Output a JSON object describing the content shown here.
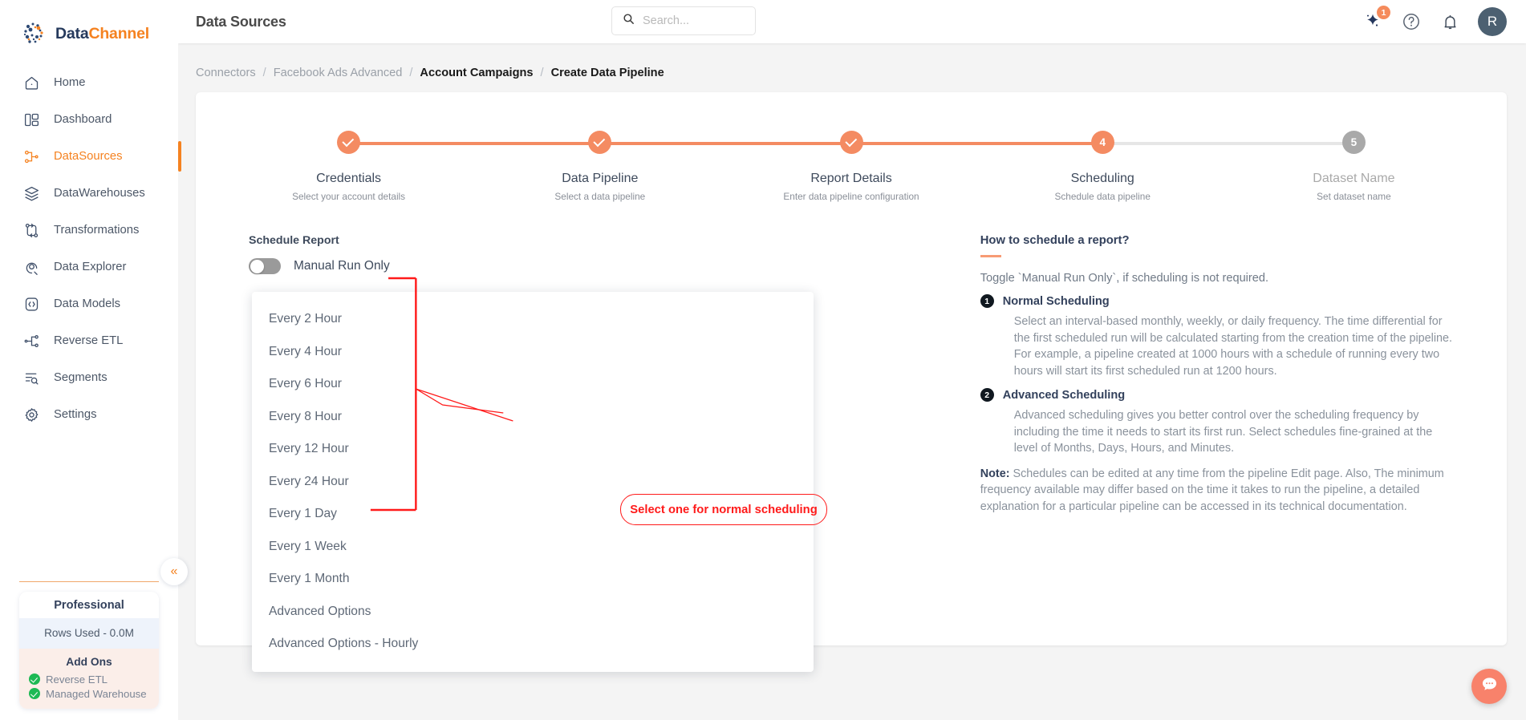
{
  "brand": {
    "part1": "Data",
    "part2": "Channel"
  },
  "sidebar": {
    "items": [
      {
        "label": "Home",
        "icon": "home-icon"
      },
      {
        "label": "Dashboard",
        "icon": "dashboard-icon"
      },
      {
        "label": "DataSources",
        "icon": "datasources-icon"
      },
      {
        "label": "DataWarehouses",
        "icon": "warehouse-icon"
      },
      {
        "label": "Transformations",
        "icon": "transformations-icon"
      },
      {
        "label": "Data Explorer",
        "icon": "explorer-icon"
      },
      {
        "label": "Data Models",
        "icon": "datamodels-icon"
      },
      {
        "label": "Reverse ETL",
        "icon": "reverse-etl-icon"
      },
      {
        "label": "Segments",
        "icon": "segments-icon"
      },
      {
        "label": "Settings",
        "icon": "gear-icon"
      }
    ],
    "active_index": 2,
    "plan": {
      "title": "Professional",
      "rows_used": "Rows Used - 0.0M",
      "addons_title": "Add Ons",
      "addons": [
        "Reverse ETL",
        "Managed Warehouse"
      ]
    },
    "collapse_icon": "«"
  },
  "header": {
    "title": "Data Sources",
    "search_placeholder": "Search...",
    "search_value": "",
    "ai_badge_count": "1",
    "avatar_initial": "R"
  },
  "breadcrumb": [
    {
      "label": "Connectors",
      "strong": false
    },
    {
      "label": "Facebook Ads Advanced",
      "strong": false
    },
    {
      "label": "Account Campaigns",
      "strong": true
    },
    {
      "label": "Create Data Pipeline",
      "strong": true
    }
  ],
  "breadcrumb_separator": "/",
  "stepper": [
    {
      "marker": "✓",
      "name": "Credentials",
      "desc": "Select your account details",
      "state": "done"
    },
    {
      "marker": "✓",
      "name": "Data Pipeline",
      "desc": "Select a data pipeline",
      "state": "done"
    },
    {
      "marker": "✓",
      "name": "Report Details",
      "desc": "Enter data pipeline configuration",
      "state": "done"
    },
    {
      "marker": "4",
      "name": "Scheduling",
      "desc": "Schedule data pipeline",
      "state": "current"
    },
    {
      "marker": "5",
      "name": "Dataset Name",
      "desc": "Set dataset name",
      "state": "upcoming"
    }
  ],
  "form": {
    "schedule_label": "Schedule Report",
    "toggle_label": "Manual Run Only",
    "toggle_state": "off",
    "options": [
      "Every 2 Hour",
      "Every 4 Hour",
      "Every 6 Hour",
      "Every 8 Hour",
      "Every 12 Hour",
      "Every 24 Hour",
      "Every 1 Day",
      "Every 1 Week",
      "Every 1 Month",
      "Advanced Options",
      "Advanced Options - Hourly"
    ]
  },
  "annotation": {
    "text": "Select one for normal scheduling",
    "color": "#ff1a1a"
  },
  "help": {
    "title": "How to schedule a report?",
    "lead": "Toggle `Manual Run Only`, if scheduling is not required.",
    "steps": [
      {
        "num": "1",
        "title": "Normal Scheduling",
        "body": "Select an interval-based monthly, weekly, or daily frequency. The time differential for the first scheduled run will be calculated starting from the creation time of the pipeline. For example, a pipeline created at 1000 hours with a schedule of running every two hours will start its first scheduled run at 1200 hours."
      },
      {
        "num": "2",
        "title": "Advanced Scheduling",
        "body": "Advanced scheduling gives you better control over the scheduling frequency by including the time it needs to start its first run. Select schedules fine-grained at the level of Months, Days, Hours, and Minutes."
      }
    ],
    "note_label": "Note:",
    "note_body": " Schedules can be edited at any time from the pipeline Edit page. Also, The minimum frequency available may differ based on the time it takes to run the pipeline, a detailed explanation for a particular pipeline can be accessed in its technical documentation."
  },
  "colors": {
    "accent": "#f58220",
    "step_active": "#f48b62",
    "step_inactive": "#a9a9a9",
    "annotation_red": "#ff1a1a",
    "chat_fab": "#f8826b"
  }
}
